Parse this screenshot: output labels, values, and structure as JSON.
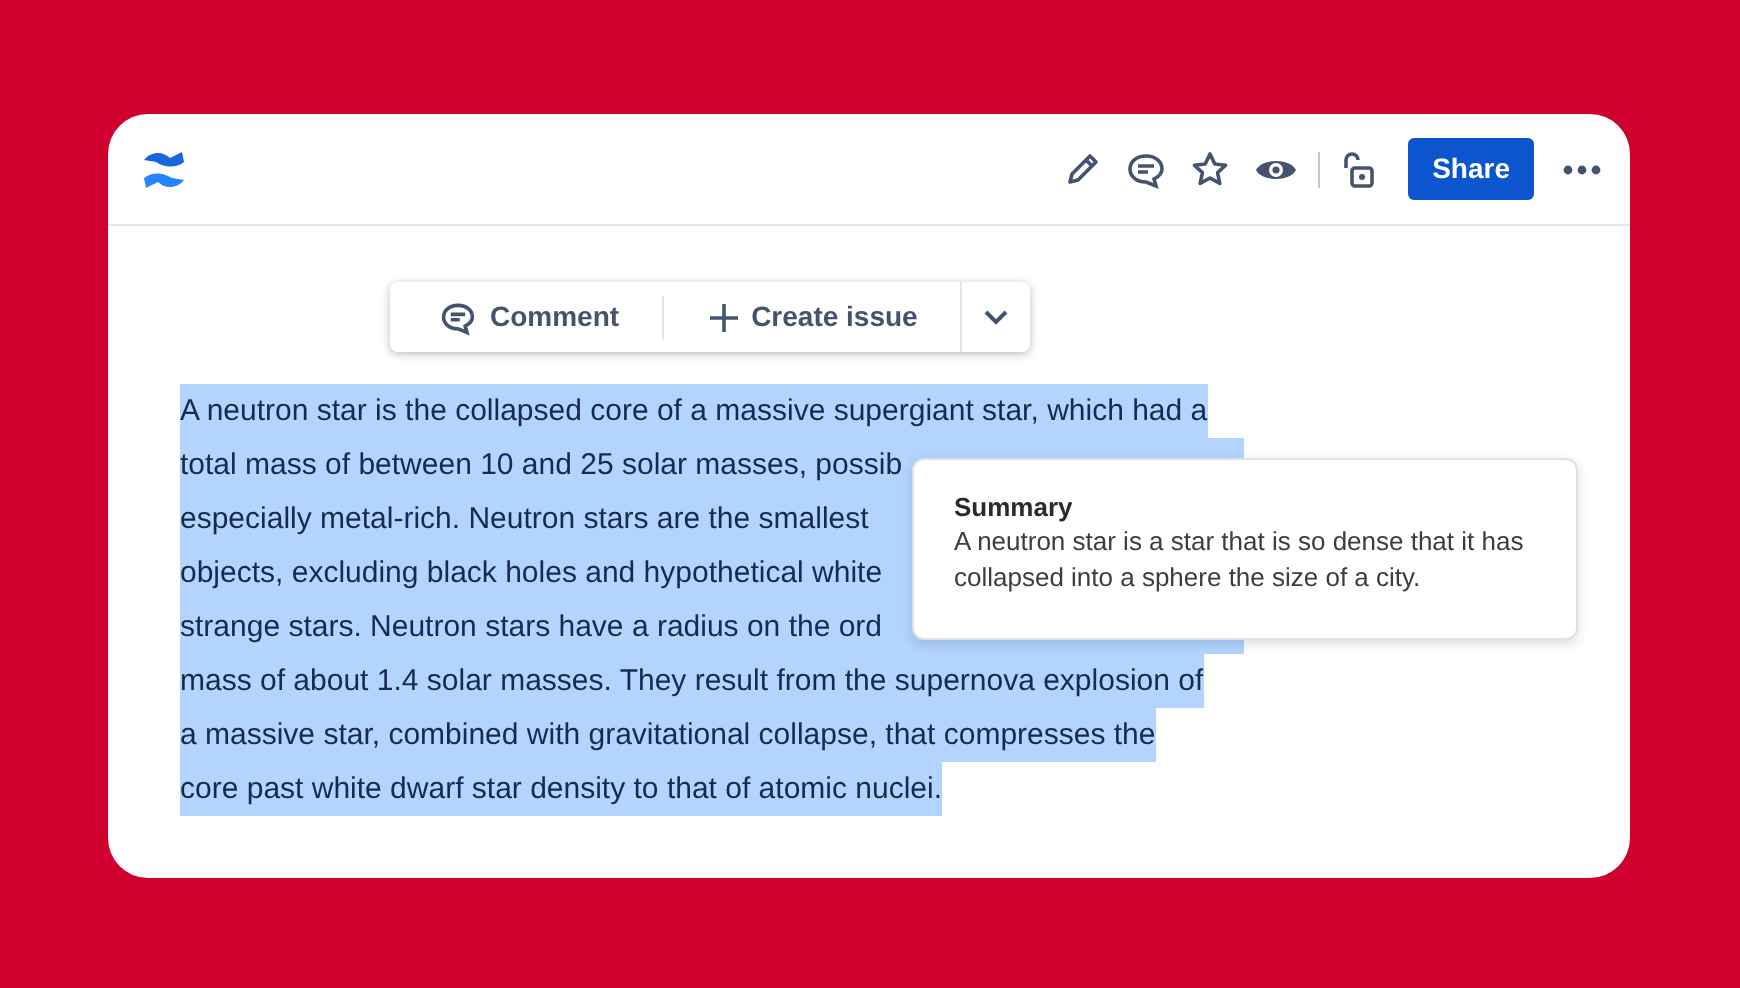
{
  "header": {
    "share_button": "Share"
  },
  "selection_toolbar": {
    "comment": "Comment",
    "create_issue": "Create issue"
  },
  "paragraph": {
    "selected": true,
    "lines": [
      "A neutron star is the collapsed core of a massive supergiant star, which had a",
      "total mass of between 10 and 25 solar masses, possib",
      "especially metal-rich. Neutron stars are the smallest",
      "objects, excluding black holes and hypothetical white",
      "strange stars. Neutron stars have a radius on the ord",
      "mass of about 1.4 solar masses. They result from the supernova explosion of",
      "a massive star, combined with gravitational collapse, that compresses the",
      "core past white dwarf star density to that of atomic nuclei."
    ]
  },
  "summary_popup": {
    "title": "Summary",
    "text": "A neutron star is a star that is so dense that it has collapsed into a sphere the size of a city."
  }
}
